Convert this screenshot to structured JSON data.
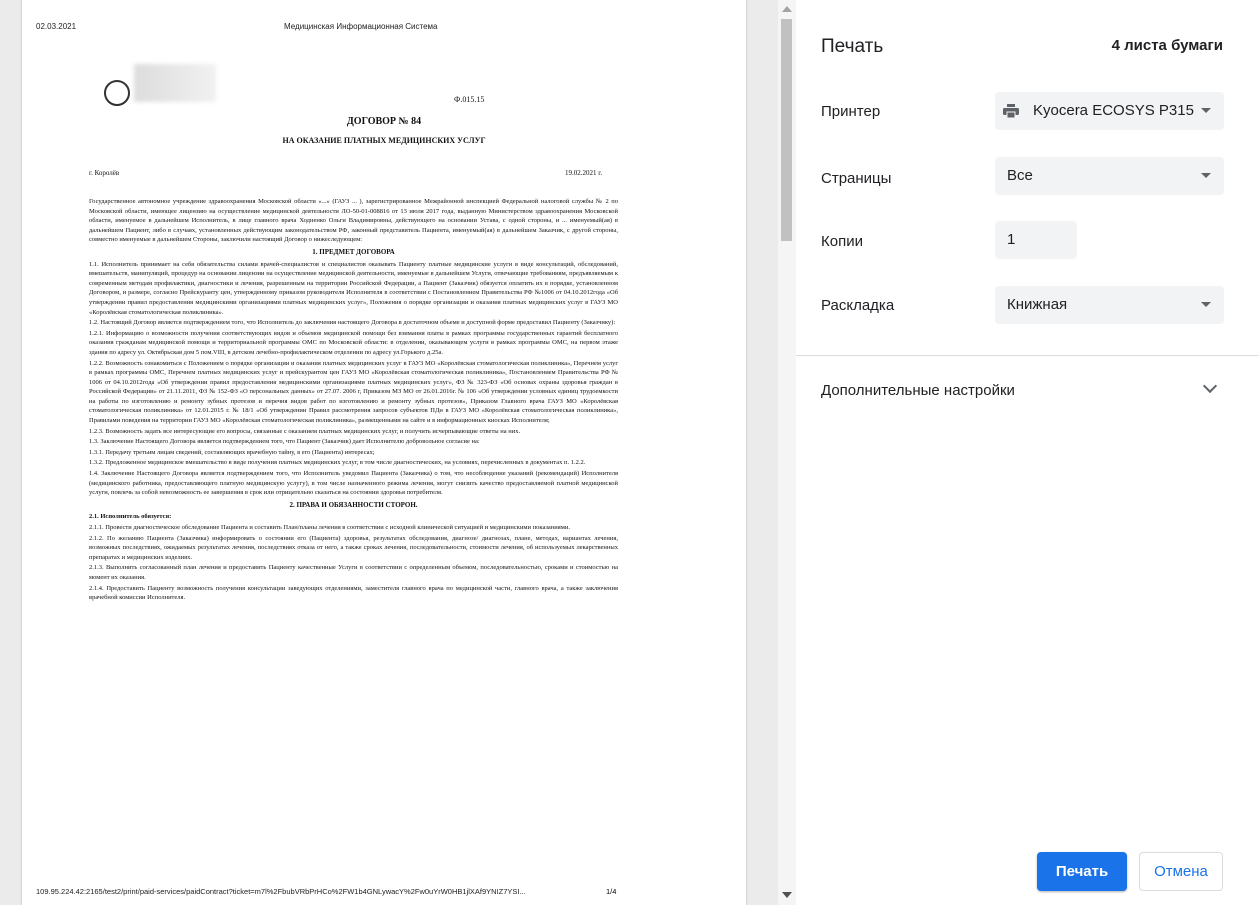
{
  "preview": {
    "header_date": "02.03.2021",
    "header_title": "Медицинская Информационная Система",
    "form_code": "Ф.015.15",
    "doc_title": "ДОГОВОР № 84",
    "doc_subtitle": "НА ОКАЗАНИЕ ПЛАТНЫХ МЕДИЦИНСКИХ УСЛУГ",
    "city": "г. Королёв",
    "doc_date": "19.02.2021 г.",
    "paragraphs": [
      "Государственное автономное учреждение здравоохранения Московской области «...» (ГАУЗ ... ), зарегистрированное Межрайонной инспекцией Федеральной налоговой службы № 2 по Московской области, имеющее лицензию на осуществление медицинской деятельности ЛО-50-01-008816 от 13 июля 2017 года, выданную Министерством здравоохранения Московской области, именуемое в дальнейшем Исполнитель, в лице главного врача Ходненко Ольги Владимировны, действующего на основании Устава, с одной стороны, и ... именуемый(ая) в дальнейшем Пациент, либо в случаях, установленных действующим законодательством РФ, законный представитель Пациента, именуемый(ая) в дальнейшем Заказчик, с другой стороны, совместно именуемые в дальнейшем Стороны, заключили настоящий Договор о нижеследующем:"
    ],
    "section1_title": "1. ПРЕДМЕТ ДОГОВОРА",
    "section1": [
      "1.1. Исполнитель принимает на себя обязательства силами врачей-специалистов и специалистов оказывать Пациенту платные медицинские услуги в виде консультаций, обследований, вмешательств, манипуляций, процедур на основании лицензии на осуществление медицинской деятельности, именуемые в дальнейшем Услуги, отвечающие требованиям, предъявляемым к современным методам профилактики, диагностики и лечения, разрешенным на территории Российской Федерации, а Пациент (Заказчик) обязуется оплатить их в порядке, установленном Договором, и размере, согласно Прейскуранту цен, утвержденному приказом руководителя Исполнителя в соответствии с Постановлением Правительства РФ №1006 от 04.10.2012года «Об утверждении правил предоставления медицинскими организациями платных медицинских услуг», Положения о порядке организации и оказания платных медицинских услуг в ГАУЗ МО «Королёвская стоматологическая поликлиника».",
      "1.2. Настоящий Договор является подтверждением того, что Исполнитель до заключения настоящего Договора в достаточном объеме и доступной форме предоставил Пациенту (Заказчику):",
      "1.2.1. Информацию о возможности получения соответствующих видов и объемов медицинской помощи без взимания платы в рамках программы государственных гарантий бесплатного оказания гражданам медицинской помощи и территориальной программы ОМС по Московской области: в отделении, оказывающем услуги в рамках программы ОМС, на первом этаже здания по адресу ул. Октябрьская дом 5 пом.VIII, в детском лечебно-профилактическом отделении по адресу ул.Горького д.25а.",
      "1.2.2. Возможность ознакомиться с Положением о порядке организации и оказания платных медицинских услуг в ГАУЗ МО «Королёвская стоматологическая поликлиника», Перечнем услуг в рамках программы ОМС, Перечнем платных медицинских услуг и прейскурантом цен ГАУЗ МО «Королёвская стоматологическая поликлиника», Постановлением Правительства РФ № 1006 от 04.10.2012года «Об утверждении правил предоставления медицинскими организациями платных медицинских услуг», ФЗ № 323-ФЗ «Об основах охраны здоровья граждан в Российской Федерации» от 21.11.2011, ФЗ № 152-ФЗ «О персональных данных» от 27.07. 2006 г, Приказом МЗ МО от 26.01.2016г. № 106 «Об утверждении условных единиц трудоемкости на работы по изготовлению и ремонту зубных протезов и перечня видов работ по изготовлению и ремонту зубных протезов», Приказом Главного врача ГАУЗ МО «Королёвская стоматологическая поликлиника» от 12.01.2015 г. № 18/1 «Об утверждении Правил рассмотрения запросов субъектов ПДн в ГАУЗ МО «Королёвская стоматологическая поликлиника», Правилами поведения на территории ГАУЗ МО «Королёвская стоматологическая поликлиника», размещенными на сайте и в информационных киосках Исполнителя;",
      "1.2.3. Возможность задать все интересующие его вопросы, связанные с оказанием платных медицинских услуг, и получить исчерпывающие ответы на них.",
      "1.3. Заключение Настоящего Договора является подтверждением того, что Пациент (Заказчик) дает Исполнителю добровольное согласие на:",
      "1.3.1. Передачу третьим лицам сведений, составляющих врачебную тайну, в его (Пациента) интересах;",
      "1.3.2. Предложенное медицинское вмешательство в виде получения платных медицинских услуг, в том числе диагностических, на условиях, перечисленных в документах п. 1.2.2.",
      "1.4. Заключение Настоящего Договора является подтверждением того, что Исполнитель уведомил Пациента (Заказчика) о том, что несоблюдение указаний (рекомендаций) Исполнителя (медицинского работника, предоставляющего платную медицинскую услугу), в том числе назначенного режима лечения, могут снизить качество предоставляемой платной медицинской услуги, повлечь за собой невозможность ее завершения в срок или отрицательно сказаться на состоянии здоровья потребителя."
    ],
    "section2_title": "2. ПРАВА И ОБЯЗАННОСТИ СТОРОН.",
    "section2_sub": "2.1. Исполнитель обязуется:",
    "section2": [
      "2.1.1. Провести диагностическое обследование Пациента и составить План/планы лечения в соответствии с исходной клинической ситуацией и медицинскими показаниями.",
      "2.1.2. По желанию Пациента (Заказчика) информировать о состоянии его (Пациента) здоровья, результатах обследования, диагнозе/ диагнозах, плане, методах, вариантах лечения, возможных последствиях, ожидаемых результатах лечения, последствиях отказа от него, а также сроках лечения, последовательности, стоимости лечения, об используемых лекарственных препаратах и медицинских изделиях.",
      "2.1.3. Выполнить согласованный план лечения и предоставить Пациенту качественные Услуги в соответствии с определенным объемом, последовательностью, сроками и стоимостью на момент их оказания.",
      "2.1.4. Предоставить Пациенту возможность получения консультации заведующих отделениями, заместителя главного врача по медицинской части, главного врача, а также заключения врачебной комиссии Исполнителя."
    ],
    "footer_url": "109.95.224.42:2165/test2/print/paid-services/paidContract?ticket=m7l%2FbubVRbPrHCo%2FW1b4GNLywacY%2Fw0uYrW0HB1jlXAf9YNIZ7YSI...",
    "page_indicator": "1/4"
  },
  "panel": {
    "title": "Печать",
    "sheets": "4 листа бумаги",
    "printer_label": "Принтер",
    "printer_value": "Kyocera ECOSYS P315",
    "pages_label": "Страницы",
    "pages_value": "Все",
    "copies_label": "Копии",
    "copies_value": "1",
    "layout_label": "Раскладка",
    "layout_value": "Книжная",
    "more_settings": "Дополнительные настройки",
    "print_button": "Печать",
    "cancel_button": "Отмена"
  },
  "colors": {
    "accent": "#1a73e8",
    "field_bg": "#f1f3f4"
  }
}
